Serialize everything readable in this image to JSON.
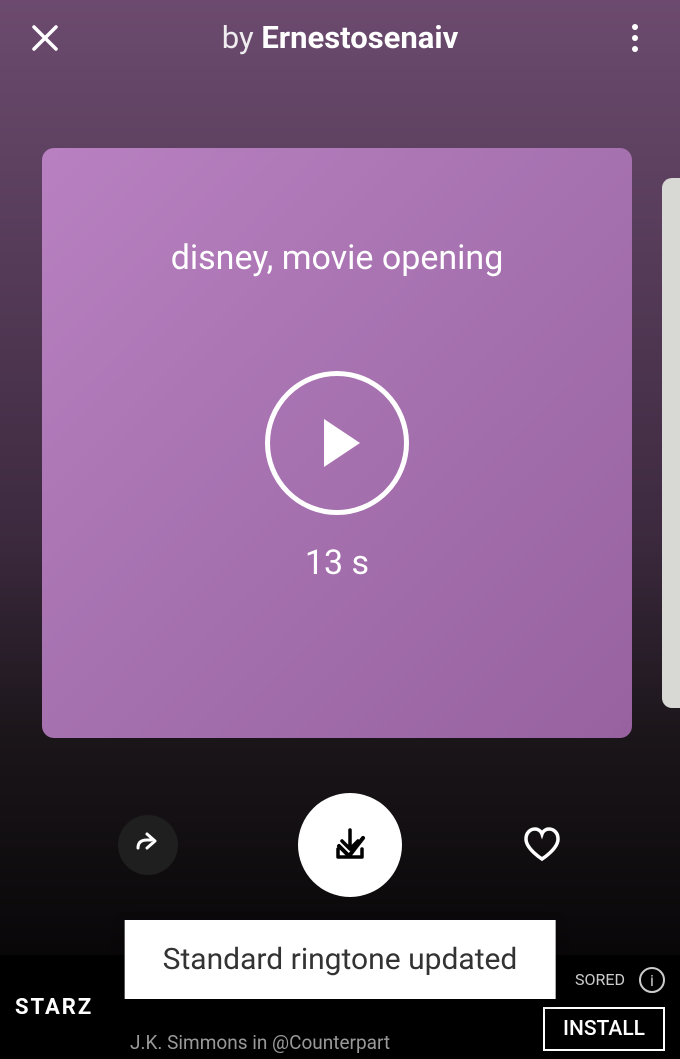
{
  "header": {
    "by_label": "by",
    "author": "Ernestosenaiv"
  },
  "card": {
    "title": "disney, movie opening",
    "duration": "13 s"
  },
  "toast": {
    "message": "Standard ringtone updated"
  },
  "ad": {
    "logo": "STARZ",
    "subtitle": "J.K. Simmons in @Counterpart",
    "sponsored": "SORED",
    "install": "INSTALL"
  }
}
